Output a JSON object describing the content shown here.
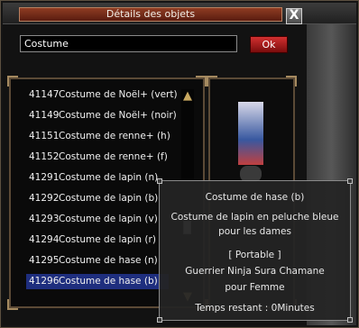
{
  "window": {
    "title": "Détails des objets",
    "close_label": "X"
  },
  "search": {
    "value": "Costume",
    "ok_label": "Ok"
  },
  "list": {
    "items": [
      {
        "id": "41147",
        "name": "Costume de Noël+ (vert)"
      },
      {
        "id": "41149",
        "name": "Costume de Noël+ (noir)"
      },
      {
        "id": "41151",
        "name": "Costume de renne+ (h)"
      },
      {
        "id": "41152",
        "name": "Costume de renne+ (f)"
      },
      {
        "id": "41291",
        "name": "Costume de lapin (n)"
      },
      {
        "id": "41292",
        "name": "Costume de lapin (b)"
      },
      {
        "id": "41293",
        "name": "Costume de lapin (v)"
      },
      {
        "id": "41294",
        "name": "Costume de lapin (r)"
      },
      {
        "id": "41295",
        "name": "Costume de hase (n)"
      },
      {
        "id": "41296",
        "name": "Costume de hase (b)"
      }
    ],
    "selected_index": 9
  },
  "tooltip": {
    "name": "Costume de hase (b)",
    "desc_line1": "Costume de lapin en peluche bleue",
    "desc_line2": "pour les dames",
    "tag": "[ Portable ]",
    "classes": "Guerrier Ninja Sura Chamane",
    "gender": "pour Femme",
    "time_left": "Temps restant : 0Minutes"
  },
  "colors": {
    "title_bar": "#8e3c22",
    "selected_row": "#1e2e7e",
    "ok_button": "#c42020"
  }
}
